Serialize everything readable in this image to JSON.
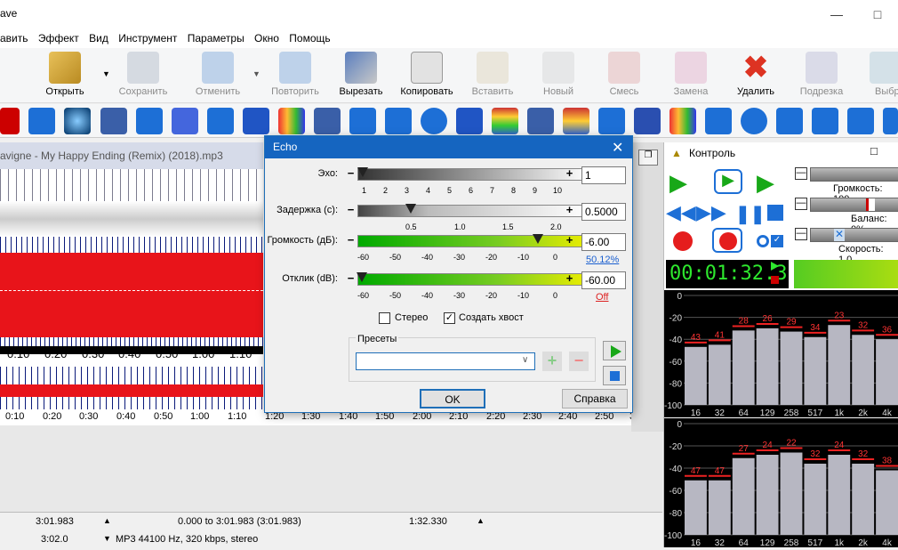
{
  "window": {
    "title": "ave"
  },
  "menu": [
    "авить",
    "Эффект",
    "Вид",
    "Инструмент",
    "Параметры",
    "Окно",
    "Помощь"
  ],
  "toolbar": [
    {
      "label": "Открыть",
      "enabled": true,
      "icon": "open-folder-icon"
    },
    {
      "label": "Сохранить",
      "enabled": false,
      "icon": "save-icon"
    },
    {
      "label": "Отменить",
      "enabled": false,
      "icon": "undo-icon"
    },
    {
      "label": "Повторить",
      "enabled": false,
      "icon": "redo-icon"
    },
    {
      "label": "Вырезать",
      "enabled": true,
      "icon": "scissors-icon"
    },
    {
      "label": "Копировать",
      "enabled": true,
      "icon": "copy-icon"
    },
    {
      "label": "Вставить",
      "enabled": false,
      "icon": "paste-icon"
    },
    {
      "label": "Новый",
      "enabled": false,
      "icon": "new-icon"
    },
    {
      "label": "Смесь",
      "enabled": false,
      "icon": "mix-icon"
    },
    {
      "label": "Замена",
      "enabled": false,
      "icon": "replace-icon"
    },
    {
      "label": "Удалить",
      "enabled": true,
      "icon": "delete-icon"
    },
    {
      "label": "Подрезка",
      "enabled": false,
      "icon": "trim-icon"
    },
    {
      "label": "Выбр",
      "enabled": false,
      "icon": "select-icon"
    }
  ],
  "waveform": {
    "title": "avigne - My Happy Ending (Remix) (2018).mp3",
    "top_timeline": [
      "0:10",
      "0:20",
      "0:30",
      "0:40",
      "0:50",
      "1:00",
      "1:10"
    ],
    "bottom_timeline": [
      "0:10",
      "0:20",
      "0:30",
      "0:40",
      "0:50",
      "1:00",
      "1:10",
      "1:20",
      "1:30",
      "1:40",
      "1:50",
      "2:00",
      "2:10",
      "2:20",
      "2:30",
      "2:40",
      "2:50",
      "3"
    ]
  },
  "status": {
    "row1": [
      "3:01.983",
      "0.000 to 3:01.983 (3:01.983)",
      "1:32.330"
    ],
    "row2": [
      "3:02.0",
      "MP3 44100 Hz, 320 kbps, stereo"
    ]
  },
  "dialog": {
    "title": "Echo",
    "echo": {
      "label": "Эхо:",
      "value": "1",
      "ticks": [
        "1",
        "2",
        "3",
        "4",
        "5",
        "6",
        "7",
        "8",
        "9",
        "10"
      ],
      "level": 0.0
    },
    "delay": {
      "label": "Задержка (с):",
      "value": "0.5000",
      "ticks": [
        "0.5",
        "1.0",
        "1.5",
        "2.0"
      ],
      "level": 0.25
    },
    "volume": {
      "label": "Громкость (дБ):",
      "value": "-6.00",
      "percent": "50.12%",
      "ticks": [
        "-60",
        "-50",
        "-40",
        "-30",
        "-20",
        "-10",
        "0"
      ],
      "level": 0.9
    },
    "response": {
      "label": "Отклик (dB):",
      "value": "-60.00",
      "state": "Off",
      "ticks": [
        "-60",
        "-50",
        "-40",
        "-30",
        "-20",
        "-10",
        "0"
      ],
      "level": 0.0
    },
    "stereo": {
      "label": "Стерео",
      "checked": false
    },
    "tail": {
      "label": "Создать хвост",
      "checked": true
    },
    "presets": {
      "label": "Пресеты",
      "value": ""
    },
    "ok_label": "OK",
    "help_label": "Справка"
  },
  "control": {
    "title": "Контроль",
    "time": "00:01:32.3",
    "volume_label": "Громкость: 100",
    "balance_label": "Баланс: 0%",
    "speed_label": "Скорость: 1.0",
    "eq_freqs": [
      "16",
      "32",
      "64",
      "129",
      "258",
      "517",
      "1k",
      "2k",
      "4k"
    ],
    "eq_top_peaks": [
      "43",
      "41",
      "28",
      "26",
      "29",
      "34",
      "23",
      "32",
      "36"
    ],
    "eq_bottom_peaks": [
      "47",
      "47",
      "27",
      "24",
      "22",
      "32",
      "24",
      "32",
      "38"
    ],
    "eq_y": [
      "0",
      "-20",
      "-40",
      "-60",
      "-80",
      "-100"
    ]
  }
}
